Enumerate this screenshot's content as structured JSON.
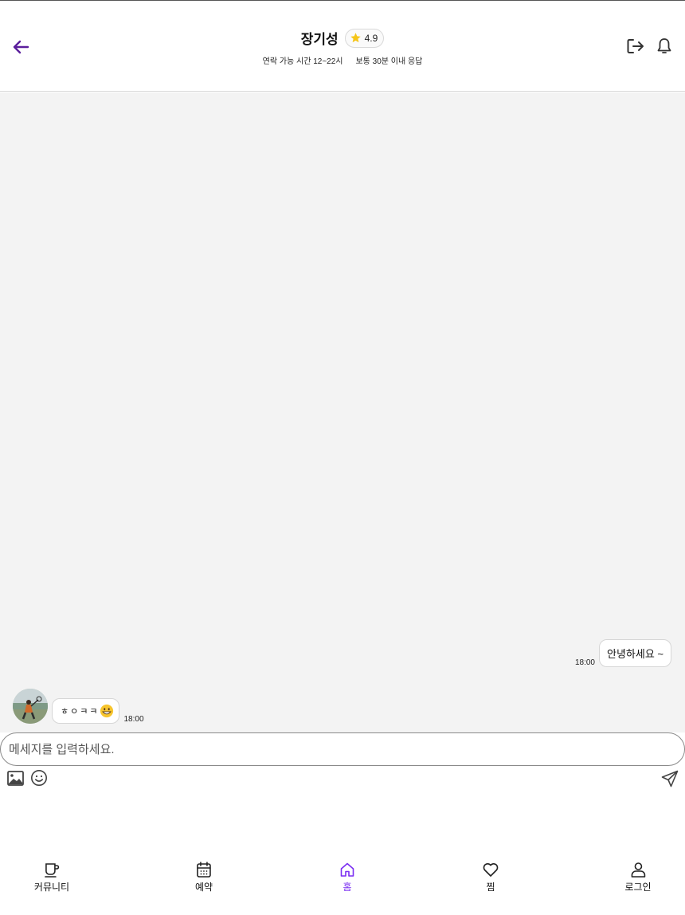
{
  "header": {
    "name": "장기성",
    "rating": "4.9",
    "contact_hours": "연락 가능 시간 12~22시",
    "response_time": "보통 30분 이내 응답"
  },
  "messages": {
    "mine": {
      "text": "안녕하세요 ~",
      "time": "18:00"
    },
    "theirs": {
      "text": "ㅎㅇㅋㅋ",
      "time": "18:00"
    }
  },
  "composer": {
    "placeholder": "메세지를 입력하세요."
  },
  "nav": {
    "items": [
      {
        "label": "커뮤니티",
        "icon": "coffee-cup-icon"
      },
      {
        "label": "예약",
        "icon": "calendar-icon"
      },
      {
        "label": "홈",
        "icon": "home-icon",
        "active": true
      },
      {
        "label": "찜",
        "icon": "heart-icon"
      },
      {
        "label": "로그인",
        "icon": "user-icon"
      }
    ]
  },
  "colors": {
    "accent": "#7b2ff2",
    "back_arrow": "#5b1f9c",
    "chat_bg": "#f3f3f3",
    "star": "#f5c518"
  }
}
